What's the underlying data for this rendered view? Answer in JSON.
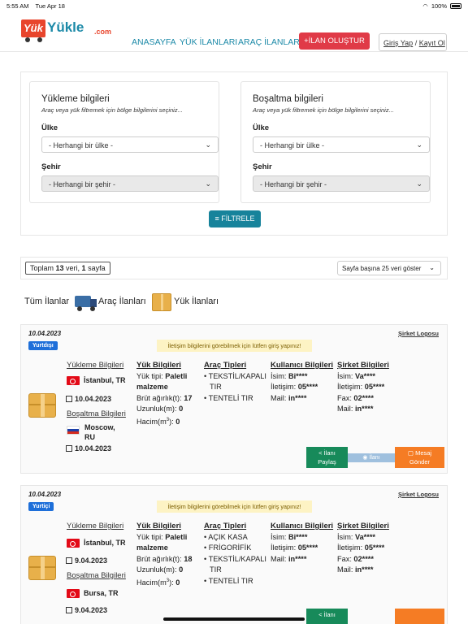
{
  "status": {
    "time": "5:55 AM",
    "date": "Tue Apr 18",
    "battery": "100%"
  },
  "brand": {
    "yuk": "Yük",
    "yukle": "Yükle",
    "com": ".com"
  },
  "nav": {
    "home": "ANASAYFA",
    "loads": "YÜK İLANLARI",
    "vehicles": "ARAÇ İLANLARI",
    "create": "+İLAN OLUŞTUR",
    "login": "Giriş Yap",
    "sep": "/",
    "register": "Kayıt Ol"
  },
  "filters": {
    "loading": {
      "title": "Yükleme bilgileri",
      "subtitle": "Araç veya yük filtremek için bölge bilgilerini seçiniz...",
      "country_label": "Ülke",
      "country_value": "- Herhangi bir ülke -",
      "city_label": "Şehir",
      "city_value": "- Herhangi bir şehir -"
    },
    "unloading": {
      "title": "Boşaltma bilgileri",
      "subtitle": "Araç veya yük filtremek için bölge bilgilerini seçiniz...",
      "country_label": "Ülke",
      "country_value": "- Herhangi bir ülke -",
      "city_label": "Şehir",
      "city_value": "- Herhangi bir şehir -"
    },
    "button": "FİLTRELE"
  },
  "results": {
    "total_prefix": "Toplam ",
    "total_count": "13",
    "total_mid": " veri, ",
    "pages": "1",
    "pages_suffix": " sayfa",
    "per_page": "Sayfa başına 25 veri göster"
  },
  "tabs": {
    "all": "Tüm İlanlar",
    "vehicles": "Araç İlanları",
    "loads": "Yük İlanları"
  },
  "listings": [
    {
      "date": "10.04.2023",
      "badge": "Yurtdışı",
      "notice": "İletişim bilgilerini görebilmek için lütfen giriş yapınız!",
      "logo_link": "Şirket Logosu",
      "loading_header": "Yükleme Bilgileri",
      "loading_place": "İstanbul, TR",
      "loading_date": "10.04.2023",
      "unloading_header": "Boşaltma Bilgileri",
      "unloading_place_1": "Moscow,",
      "unloading_place_2": "RU",
      "unloading_date": "10.04.2023",
      "load_header": "Yük Bilgileri",
      "load_type_label": "Yük tipi: ",
      "load_type_1": "Paletli",
      "load_type_2": "malzeme",
      "weight_label": "Brüt ağırlık(t): ",
      "weight": "17",
      "length_label": "Uzunluk(m): ",
      "length": "0",
      "volume_label": "Hacim(m",
      "volume_sup": "3",
      "volume_close": "): ",
      "volume": "0",
      "vehicle_header": "Araç Tipleri",
      "vehicles": [
        "TEKSTİL/KAPALI TIR",
        "TENTELİ TIR"
      ],
      "user_header": "Kullanıcı Bilgileri",
      "user_name_label": "İsim: ",
      "user_name": "Bi****",
      "user_phone_label": "İletişim: ",
      "user_phone": "05****",
      "user_mail_label": "Mail: ",
      "user_mail": "in****",
      "company_header": "Şirket Bilgileri",
      "company_name_label": "İsim: ",
      "company_name": "Va****",
      "company_phone_label": "İletişim: ",
      "company_phone": "05****",
      "company_fax_label": "Fax: ",
      "company_fax": "02****",
      "company_mail_label": "Mail: ",
      "company_mail": "in****",
      "share_1": "İlanı",
      "share_2": "Paylaş",
      "view": "İlanı",
      "msg_1": "Mesaj",
      "msg_2": "Gönder"
    },
    {
      "date": "10.04.2023",
      "badge": "Yurtiçi",
      "notice": "İletişim bilgilerini görebilmek için lütfen giriş yapınız!",
      "logo_link": "Şirket Logosu",
      "loading_header": "Yükleme Bilgileri",
      "loading_place": "İstanbul, TR",
      "loading_date": "9.04.2023",
      "unloading_header": "Boşaltma Bilgileri",
      "unloading_place_1": "Bursa, TR",
      "unloading_date": "9.04.2023",
      "load_header": "Yük Bilgileri",
      "load_type_label": "Yük tipi: ",
      "load_type_1": "Paletli",
      "load_type_2": "malzeme",
      "weight_label": "Brüt ağırlık(t): ",
      "weight": "18",
      "length_label": "Uzunluk(m): ",
      "length": "0",
      "volume_label": "Hacim(m",
      "volume_sup": "3",
      "volume_close": "): ",
      "volume": "0",
      "vehicle_header": "Araç Tipleri",
      "vehicles": [
        "AÇIK KASA",
        "FRİGORİFİK",
        "TEKSTİL/KAPALI TIR",
        "TENTELİ TIR"
      ],
      "user_header": "Kullanıcı Bilgileri",
      "user_name_label": "İsim: ",
      "user_name": "Bi****",
      "user_phone_label": "İletişim: ",
      "user_phone": "05****",
      "user_mail_label": "Mail: ",
      "user_mail": "in****",
      "company_header": "Şirket Bilgileri",
      "company_name_label": "İsim: ",
      "company_name": "Va****",
      "company_phone_label": "İletişim: ",
      "company_phone": "05****",
      "company_fax_label": "Fax: ",
      "company_fax": "02****",
      "company_mail_label": "Mail: ",
      "company_mail": "in****",
      "share_1": "İlanı"
    }
  ]
}
